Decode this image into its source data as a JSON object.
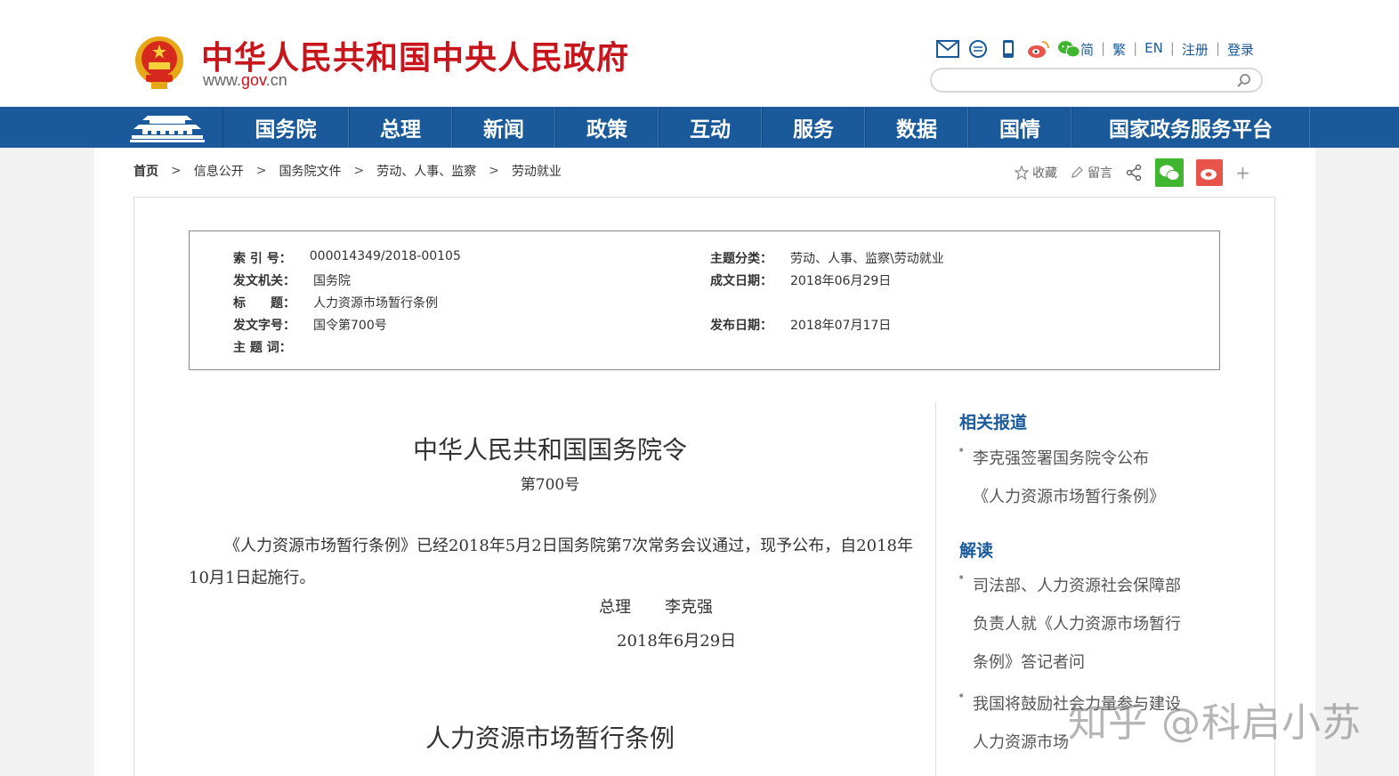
{
  "header": {
    "site_title": "中华人民共和国中央人民政府",
    "site_url_prefix": "www.",
    "site_url_domain": "gov",
    "site_url_suffix": ".cn",
    "lang_links": [
      "简",
      "繁",
      "EN",
      "注册",
      "登录"
    ],
    "search_placeholder": ""
  },
  "nav": {
    "items": [
      "国务院",
      "总理",
      "新闻",
      "政策",
      "互动",
      "服务",
      "数据",
      "国情",
      "国家政务服务平台"
    ]
  },
  "breadcrumb": {
    "items": [
      "首页",
      "信息公开",
      "国务院文件",
      "劳动、人事、监察",
      "劳动就业"
    ]
  },
  "tools": {
    "favorite": "收藏",
    "comment": "留言"
  },
  "info": {
    "index_label": "索 引 号：",
    "index_value": "000014349/2018-00105",
    "topic_label": "主题分类：",
    "topic_value": "劳动、人事、监察\\劳动就业",
    "issuer_label": "发文机关：",
    "issuer_value": "国务院",
    "date_label": "成文日期：",
    "date_value": "2018年06月29日",
    "title_label": "标　　题：",
    "title_value": "人力资源市场暂行条例",
    "docno_label": "发文字号：",
    "docno_value": "国令第700号",
    "pub_label": "发布日期：",
    "pub_value": "2018年07月17日",
    "keyword_label": "主 题 词："
  },
  "article": {
    "title": "中华人民共和国国务院令",
    "subtitle": "第700号",
    "paragraph": "《人力资源市场暂行条例》已经2018年5月2日国务院第7次常务会议通过，现予公布，自2018年10月1日起施行。",
    "sign_role": "总理",
    "sign_name": "李克强",
    "date": "2018年6月29日",
    "title2": "人力资源市场暂行条例"
  },
  "sidebar": {
    "related_head": "相关报道",
    "related_items": [
      [
        "李克强签署国务院令公布",
        "《人力资源市场暂行条例》"
      ]
    ],
    "interpret_head": "解读",
    "interpret_items": [
      [
        "司法部、人力资源社会保障部",
        "负责人就《人力资源市场暂行",
        "条例》答记者问"
      ],
      [
        "我国将鼓励社会力量参与建设",
        "人力资源市场"
      ]
    ]
  },
  "watermark": "知乎 @科启小苏",
  "colors": {
    "brand_red": "#c8141b",
    "nav_blue": "#1a5a9a"
  }
}
